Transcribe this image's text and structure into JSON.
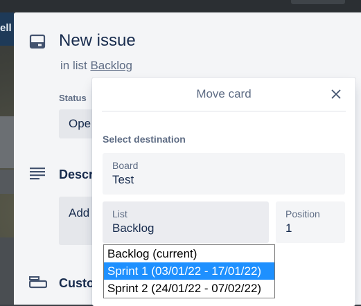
{
  "background": {
    "list_header_fragment": "ell"
  },
  "issue": {
    "title": "New issue",
    "in_list_prefix": "in list",
    "in_list_link": "Backlog",
    "status_label": "Status",
    "status_value": "Ope",
    "description_title": "Descr",
    "description_placeholder": "Add",
    "custom_fields_title": "Custo"
  },
  "move_card": {
    "title": "Move card",
    "section_title": "Select destination",
    "board": {
      "label": "Board",
      "value": "Test"
    },
    "list": {
      "label": "List",
      "value": "Backlog"
    },
    "position": {
      "label": "Position",
      "value": "1"
    },
    "list_options": [
      {
        "label": "Backlog (current)",
        "selected": false
      },
      {
        "label": "Sprint 1 (03/01/22 - 17/01/22)",
        "selected": true
      },
      {
        "label": "Sprint 2 (24/01/22 - 07/02/22)",
        "selected": false
      }
    ]
  },
  "colors": {
    "selection": "#1e90ff",
    "text_primary": "#172b4d",
    "text_subtle": "#5e6c84"
  }
}
